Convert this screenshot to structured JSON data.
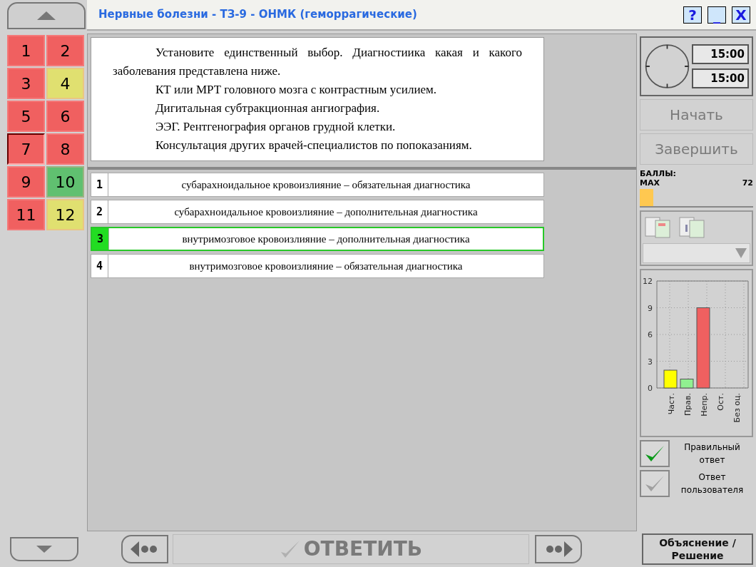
{
  "window": {
    "title": "Нервные болезни - ТЗ-9 - ОНМК (геморрагические)",
    "controls": [
      "?",
      "_",
      "X"
    ]
  },
  "question_tiles": [
    {
      "label": "1",
      "color": "#f06060",
      "selected": false
    },
    {
      "label": "2",
      "color": "#f06060",
      "selected": false
    },
    {
      "label": "3",
      "color": "#f06060",
      "selected": false
    },
    {
      "label": "4",
      "color": "#e0e070",
      "selected": false
    },
    {
      "label": "5",
      "color": "#f06060",
      "selected": false
    },
    {
      "label": "6",
      "color": "#f06060",
      "selected": false
    },
    {
      "label": "7",
      "color": "#f06060",
      "selected": true
    },
    {
      "label": "8",
      "color": "#f06060",
      "selected": false
    },
    {
      "label": "9",
      "color": "#f06060",
      "selected": false
    },
    {
      "label": "10",
      "color": "#60c070",
      "selected": false
    },
    {
      "label": "11",
      "color": "#f06060",
      "selected": false
    },
    {
      "label": "12",
      "color": "#e0e070",
      "selected": false
    }
  ],
  "question": {
    "paragraphs": [
      "Установите единственный выбор. Диагностиика какая и какого заболевания представлена ниже.",
      "КТ или МРТ головного мозга с контрастным усилием.",
      "Дигитальная субтракционная ангиография.",
      "ЭЭГ. Рентгенография органов грудной клетки.",
      "Консультация других врачей-специалистов по попоказаниям."
    ]
  },
  "answers": [
    {
      "number": "1",
      "text": "субарахноидальное кровоизлияние – обязательная диагностика",
      "selected": false
    },
    {
      "number": "2",
      "text": "субарахноидальное кровоизлияние – дополнительная диагностика",
      "selected": false
    },
    {
      "number": "3",
      "text": "внутримозговое кровоизлияние – дополнительная диагностика",
      "selected": true
    },
    {
      "number": "4",
      "text": "внутримозговое кровоизлияние – обязательная диагностика",
      "selected": false
    }
  ],
  "timer": {
    "total": "15:00",
    "remaining": "15:00"
  },
  "start_button": {
    "label": "Начать",
    "disabled": true
  },
  "finish_button": {
    "label": "Завершить",
    "disabled": true
  },
  "score": {
    "title": "БАЛЛЫ:",
    "max_label": "MAX",
    "max_value": "72",
    "level": 0.12
  },
  "stats": {
    "chart_data": {
      "type": "bar",
      "categories": [
        "Част.",
        "Прав.",
        "Непр.",
        "Ост.",
        "Без оц."
      ],
      "values": [
        2,
        1,
        9,
        0,
        0
      ],
      "colors": [
        "#ffff00",
        "#90f090",
        "#f06060",
        null,
        null
      ],
      "ylim": [
        0,
        12
      ],
      "yticks": [
        0,
        3,
        6,
        9,
        12
      ],
      "grid": true
    }
  },
  "show_correct": {
    "label": "Правильный ответ",
    "checked": true
  },
  "show_user": {
    "label": "Ответ пользователя",
    "checked": false
  },
  "answer_button": {
    "label": "ОТВЕТИТЬ",
    "disabled": true
  },
  "explain_button": {
    "label": "Объяснение / Решение"
  }
}
